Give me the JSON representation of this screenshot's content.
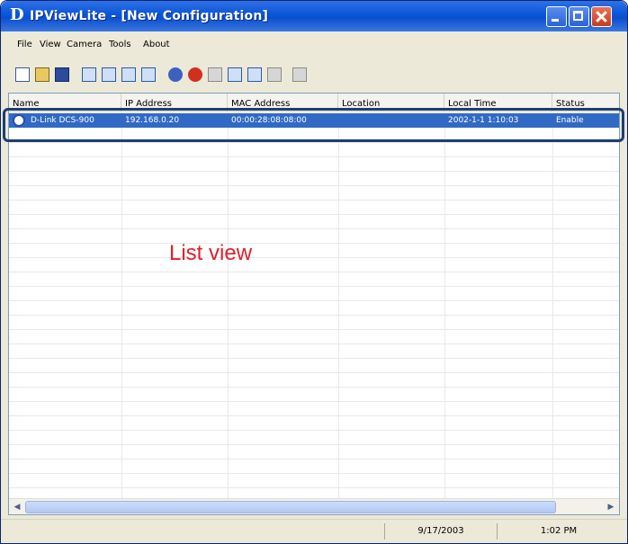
{
  "window": {
    "title": "IPViewLite - [New Configuration]",
    "logo_letter": "D"
  },
  "menu": [
    "File",
    "View",
    "Camera",
    "Tools",
    "About"
  ],
  "toolbar_icons": [
    "new-icon",
    "open-icon",
    "save-icon",
    "view-single-icon",
    "view-quad-icon",
    "view-grid-icon",
    "view-info-icon",
    "camera-add-icon",
    "camera-remove-icon",
    "camera-edit-icon",
    "snapshot-icon",
    "record-icon",
    "stop-icon",
    "about-icon"
  ],
  "columns": [
    "Name",
    "IP Address",
    "MAC Address",
    "Location",
    "Local Time",
    "Status"
  ],
  "rows": [
    {
      "name": "D-Link DCS-900",
      "ip": "192.168.0.20",
      "mac": "00:00:28:08:08:00",
      "location": "",
      "local_time": "2002-1-1 1:10:03",
      "status": "Enable"
    }
  ],
  "annotation": "List view",
  "status_bar": {
    "date": "9/17/2003",
    "time": "1:02 PM"
  },
  "colors": {
    "title_bar": "#0a55d8",
    "selection": "#316ac5",
    "annotation": "#e0202a",
    "outline": "#1e3f6e"
  }
}
